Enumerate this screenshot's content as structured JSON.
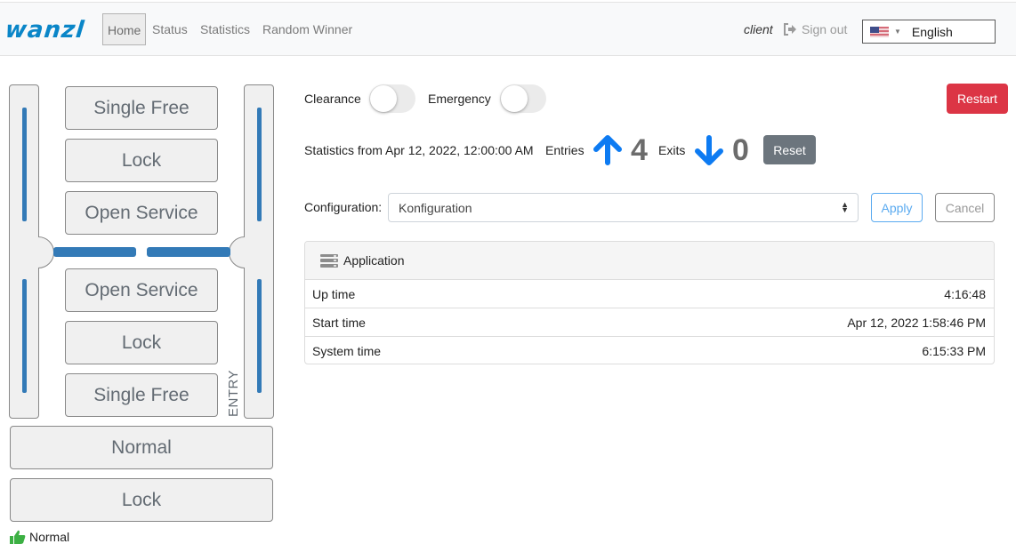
{
  "navbar": {
    "logo": "wanzl",
    "items": [
      {
        "label": "Home",
        "active": true
      },
      {
        "label": "Status",
        "active": false
      },
      {
        "label": "Statistics",
        "active": false
      },
      {
        "label": "Random Winner",
        "active": false
      }
    ],
    "user": "client",
    "sign_out": "Sign out",
    "language": "English",
    "language_flag": "us-flag-icon"
  },
  "gate": {
    "upper_modes": [
      "Single Free",
      "Lock",
      "Open Service"
    ],
    "lower_modes": [
      "Open Service",
      "Lock",
      "Single Free"
    ],
    "entry_label": "ENTRY",
    "global_modes": [
      "Normal",
      "Lock"
    ],
    "status": "Normal",
    "status_icon": "thumbs-up-icon",
    "colors": {
      "bar": "#337ab7",
      "status_icon": "#3cb043"
    }
  },
  "controls": {
    "clearance_label": "Clearance",
    "clearance_on": false,
    "emergency_label": "Emergency",
    "emergency_on": false,
    "restart_label": "Restart",
    "restart_color": "#dc3545"
  },
  "statistics": {
    "from_text": "Statistics from Apr 12, 2022, 12:00:00 AM",
    "entries_label": "Entries",
    "entries_count": "4",
    "exits_label": "Exits",
    "exits_count": "0",
    "reset_label": "Reset",
    "arrow_color": "#0d7bf2"
  },
  "configuration": {
    "label": "Configuration:",
    "selected": "Konfiguration",
    "apply_label": "Apply",
    "cancel_label": "Cancel"
  },
  "application": {
    "title": "Application",
    "rows": [
      {
        "label": "Up time",
        "value": "4:16:48"
      },
      {
        "label": "Start time",
        "value": "Apr 12, 2022 1:58:46 PM"
      },
      {
        "label": "System time",
        "value": "6:15:33 PM"
      }
    ]
  }
}
